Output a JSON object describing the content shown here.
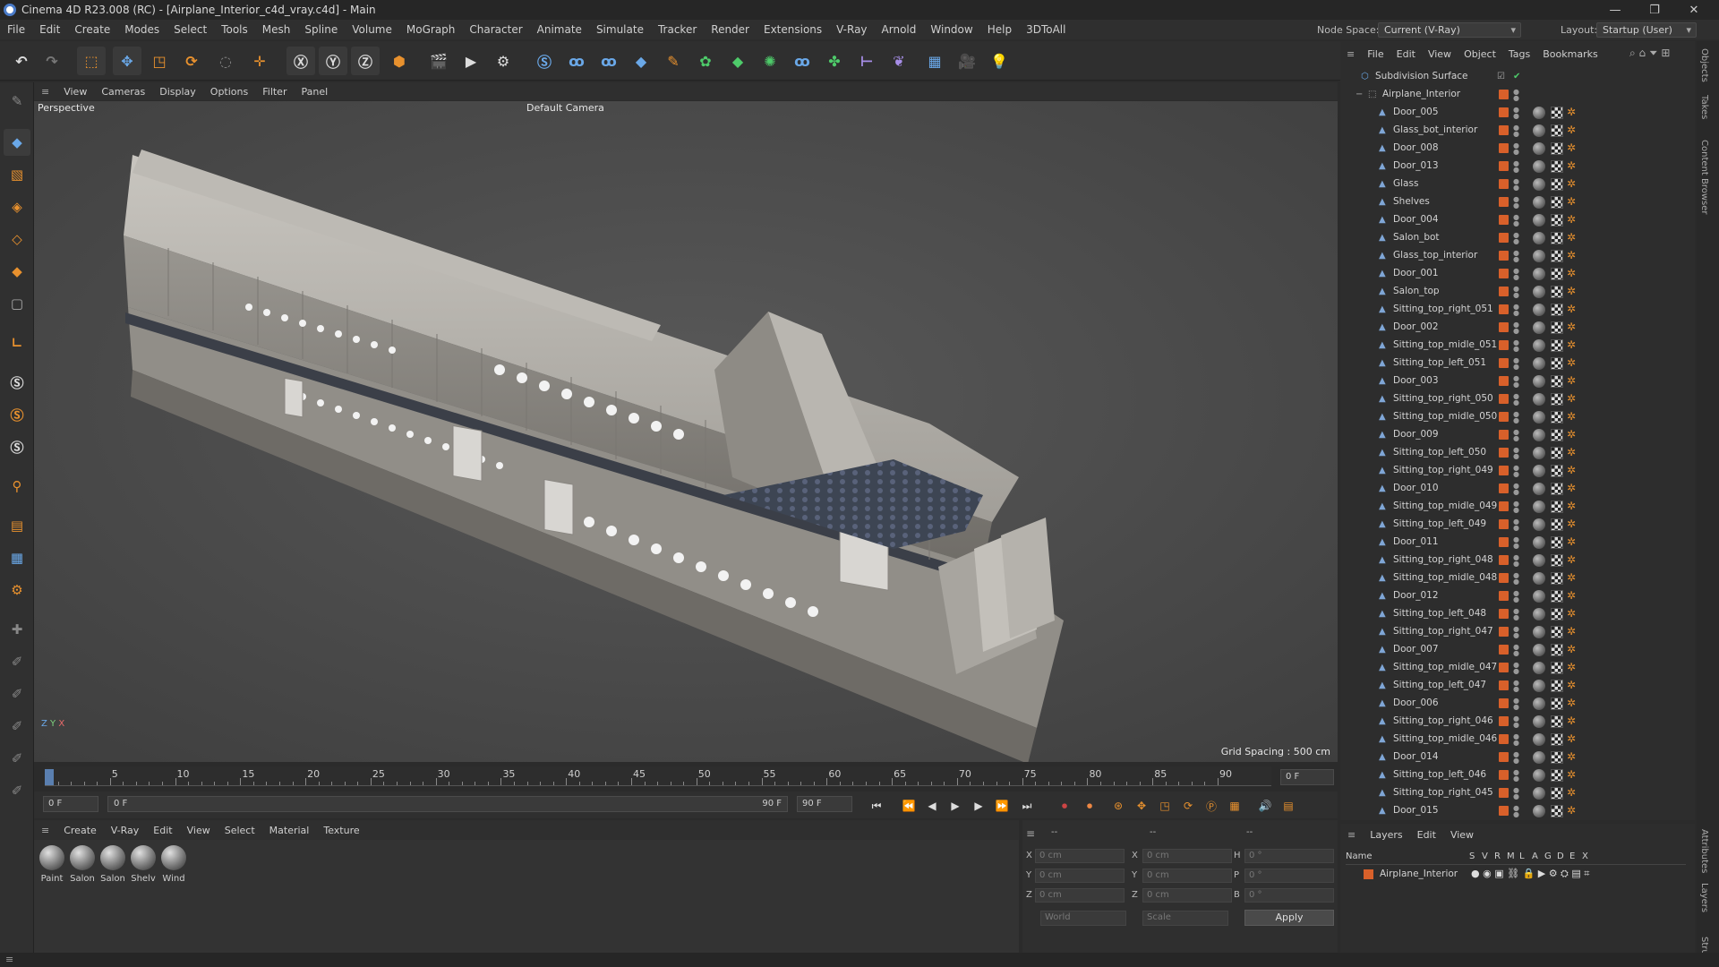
{
  "window": {
    "title": "Cinema 4D R23.008 (RC) - [Airplane_Interior_c4d_vray.c4d] - Main"
  },
  "menu": [
    "File",
    "Edit",
    "Create",
    "Modes",
    "Select",
    "Tools",
    "Mesh",
    "Spline",
    "Volume",
    "MoGraph",
    "Character",
    "Animate",
    "Simulate",
    "Tracker",
    "Render",
    "Extensions",
    "V-Ray",
    "Arnold",
    "Window",
    "Help",
    "3DToAll"
  ],
  "nodespace": {
    "label": "Node Space:",
    "value": "Current (V-Ray)"
  },
  "layout": {
    "label": "Layout:",
    "value": "Startup (User)"
  },
  "viewport": {
    "menu": [
      "View",
      "Cameras",
      "Display",
      "Options",
      "Filter",
      "Panel"
    ],
    "name": "Perspective",
    "camera": "Default Camera",
    "grid": "Grid Spacing : 500 cm"
  },
  "timeline": {
    "ticks": [
      "0",
      "5",
      "10",
      "15",
      "20",
      "25",
      "30",
      "35",
      "40",
      "45",
      "50",
      "55",
      "60",
      "65",
      "70",
      "75",
      "80",
      "85",
      "90"
    ],
    "frame_right": "0 F",
    "start": "0 F",
    "current": "0 F",
    "end": "90 F",
    "end2": "90 F"
  },
  "material": {
    "menu": [
      "Create",
      "V-Ray",
      "Edit",
      "View",
      "Select",
      "Material",
      "Texture"
    ],
    "items": [
      "Paint",
      "Salon",
      "Salon",
      "Shelv",
      "Wind"
    ]
  },
  "coords": {
    "header1": "--",
    "header2": "--",
    "header3": "--",
    "x": "0 cm",
    "y": "0 cm",
    "z": "0 cm",
    "sx": "0 cm",
    "sy": "0 cm",
    "sz": "0 cm",
    "h": "0 °",
    "p": "0 °",
    "b": "0 °",
    "mode1": "World",
    "mode2": "Scale",
    "apply": "Apply"
  },
  "objects": {
    "menu": [
      "File",
      "Edit",
      "View",
      "Object",
      "Tags",
      "Bookmarks"
    ],
    "root": "Subdivision Surface",
    "group": "Airplane_Interior",
    "items": [
      "Door_005",
      "Glass_bot_interior",
      "Door_008",
      "Door_013",
      "Glass",
      "Shelves",
      "Door_004",
      "Salon_bot",
      "Glass_top_interior",
      "Door_001",
      "Salon_top",
      "Sitting_top_right_051",
      "Door_002",
      "Sitting_top_midle_051",
      "Sitting_top_left_051",
      "Door_003",
      "Sitting_top_right_050",
      "Sitting_top_midle_050",
      "Door_009",
      "Sitting_top_left_050",
      "Sitting_top_right_049",
      "Door_010",
      "Sitting_top_midle_049",
      "Sitting_top_left_049",
      "Door_011",
      "Sitting_top_right_048",
      "Sitting_top_midle_048",
      "Door_012",
      "Sitting_top_left_048",
      "Sitting_top_right_047",
      "Door_007",
      "Sitting_top_midle_047",
      "Sitting_top_left_047",
      "Door_006",
      "Sitting_top_right_046",
      "Sitting_top_midle_046",
      "Door_014",
      "Sitting_top_left_046",
      "Sitting_top_right_045",
      "Door_015"
    ]
  },
  "layers": {
    "menu": [
      "Layers",
      "Edit",
      "View"
    ],
    "cols": [
      "Name",
      "S",
      "V",
      "R",
      "M",
      "L",
      "A",
      "G",
      "D",
      "E",
      "X"
    ],
    "row": "Airplane_Interior"
  },
  "sidetabs": [
    "Objects",
    "Takes",
    "Content Browser",
    "Attributes",
    "Layers",
    "Struct"
  ]
}
